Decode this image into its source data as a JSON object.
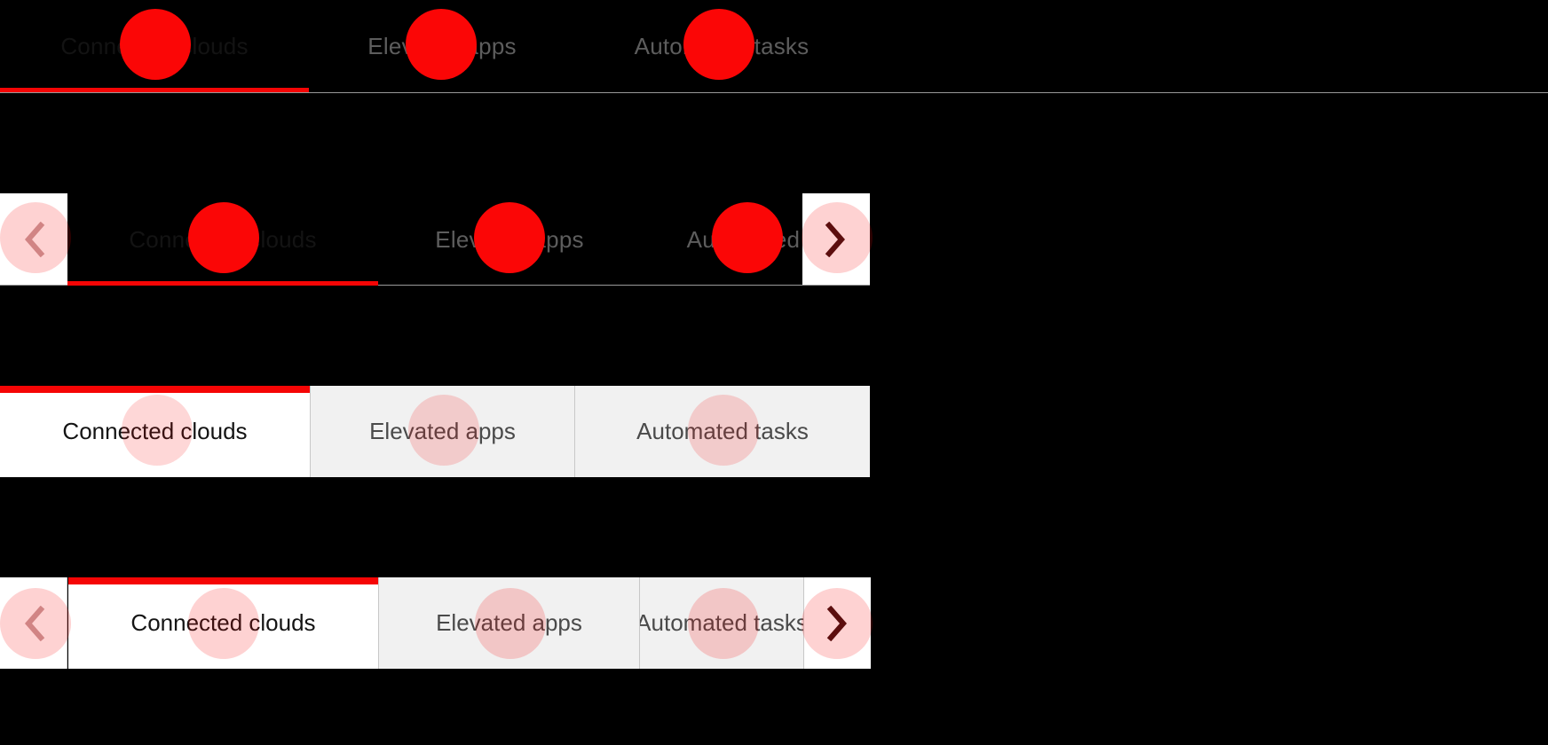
{
  "theme": {
    "background": "#000000",
    "accent_red": "#f50505",
    "marker_red": "#fb0606",
    "active_text_dark": "#131313",
    "inactive_text": "#5d5d5d",
    "tab_inactive_bg": "#f1f1f1",
    "tab_active_bg": "#ffffff",
    "divider": "#c8c8c8",
    "rule": "#9a9a9a",
    "arrow_button_bg": "#ffffff",
    "arrow_glyph_light": "#c8a0a0",
    "arrow_glyph_dark": "#3a1010"
  },
  "tab_labels": {
    "connected_clouds": "Connected clouds",
    "elevated_apps": "Elevated apps",
    "automated_tasks": "Automated tasks"
  },
  "variants": [
    {
      "id": "underline-plain",
      "style": "underline",
      "scroll_arrows": false,
      "tabs": [
        {
          "label": "Connected clouds",
          "active": true
        },
        {
          "label": "Elevated apps",
          "active": false
        },
        {
          "label": "Automated tasks",
          "active": false
        }
      ]
    },
    {
      "id": "underline-scrollable",
      "style": "underline",
      "scroll_arrows": true,
      "prev_icon": "chevron-left-icon",
      "next_icon": "chevron-right-icon",
      "tabs": [
        {
          "label": "Connected clouds",
          "active": true
        },
        {
          "label": "Elevated apps",
          "active": false
        },
        {
          "label": "Automated tasks",
          "active": false
        }
      ]
    },
    {
      "id": "boxed-plain",
      "style": "boxed",
      "scroll_arrows": false,
      "tabs": [
        {
          "label": "Connected clouds",
          "active": true
        },
        {
          "label": "Elevated apps",
          "active": false
        },
        {
          "label": "Automated tasks",
          "active": false
        }
      ]
    },
    {
      "id": "boxed-scrollable",
      "style": "boxed",
      "scroll_arrows": true,
      "prev_icon": "chevron-left-icon",
      "next_icon": "chevron-right-icon",
      "tabs": [
        {
          "label": "Connected clouds",
          "active": true
        },
        {
          "label": "Elevated apps",
          "active": false
        },
        {
          "label": "Automated tasks",
          "active": false
        }
      ]
    }
  ]
}
